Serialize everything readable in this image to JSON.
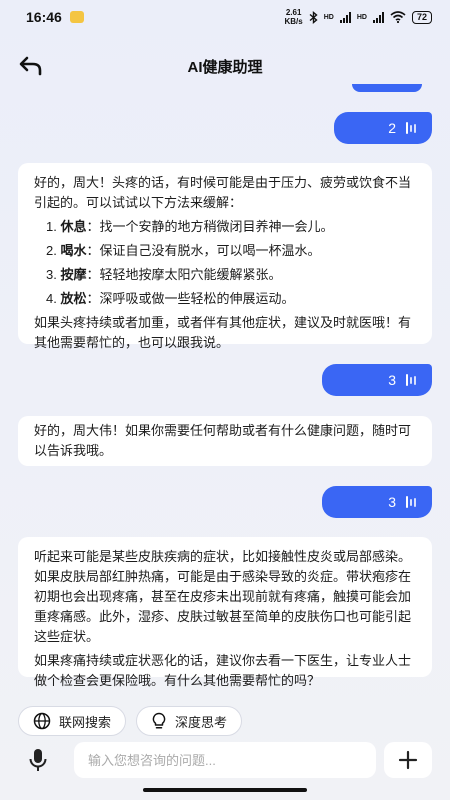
{
  "status": {
    "time": "16:46",
    "net_speed_value": "2.61",
    "net_speed_unit": "KB/s",
    "hd1": "HD",
    "hd2": "HD",
    "battery": "72"
  },
  "header": {
    "title": "AI健康助理"
  },
  "messages": [
    {
      "role": "user",
      "text": "2"
    },
    {
      "role": "assistant",
      "intro": "好的，周大！头疼的话，有时候可能是由于压力、疲劳或饮食不当引起的。可以试试以下方法来缓解：",
      "items": [
        {
          "num": "1.",
          "title": "休息",
          "text": "：找一个安静的地方稍微闭目养神一会儿。"
        },
        {
          "num": "2.",
          "title": "喝水",
          "text": "：保证自己没有脱水，可以喝一杯温水。"
        },
        {
          "num": "3.",
          "title": "按摩",
          "text": "：轻轻地按摩太阳穴能缓解紧张。"
        },
        {
          "num": "4.",
          "title": "放松",
          "text": "：深呼吸或做一些轻松的伸展运动。"
        }
      ],
      "outro": "如果头疼持续或者加重，或者伴有其他症状，建议及时就医哦！有其他需要帮忙的，也可以跟我说。"
    },
    {
      "role": "user",
      "text": "3"
    },
    {
      "role": "assistant",
      "intro": "好的，周大伟！如果你需要任何帮助或者有什么健康问题，随时可以告诉我哦。"
    },
    {
      "role": "user",
      "text": "3"
    },
    {
      "role": "assistant",
      "intro": "听起来可能是某些皮肤疾病的症状，比如接触性皮炎或局部感染。如果皮肤局部红肿热痛，可能是由于感染导致的炎症。带状疱疹在初期也会出现疼痛，甚至在皮疹未出现前就有疼痛，触摸可能会加重疼痛感。此外，湿疹、皮肤过敏甚至简单的皮肤伤口也可能引起这些症状。",
      "outro": "如果疼痛持续或症状恶化的话，建议你去看一下医生，让专业人士做个检查会更保险哦。有什么其他需要帮忙的吗？"
    }
  ],
  "toolbar": {
    "web_search_label": "联网搜索",
    "deep_think_label": "深度思考"
  },
  "input": {
    "placeholder": "输入您想咨询的问题..."
  },
  "colors": {
    "accent": "#3a66f4",
    "bubble_bg": "#ffffff"
  }
}
